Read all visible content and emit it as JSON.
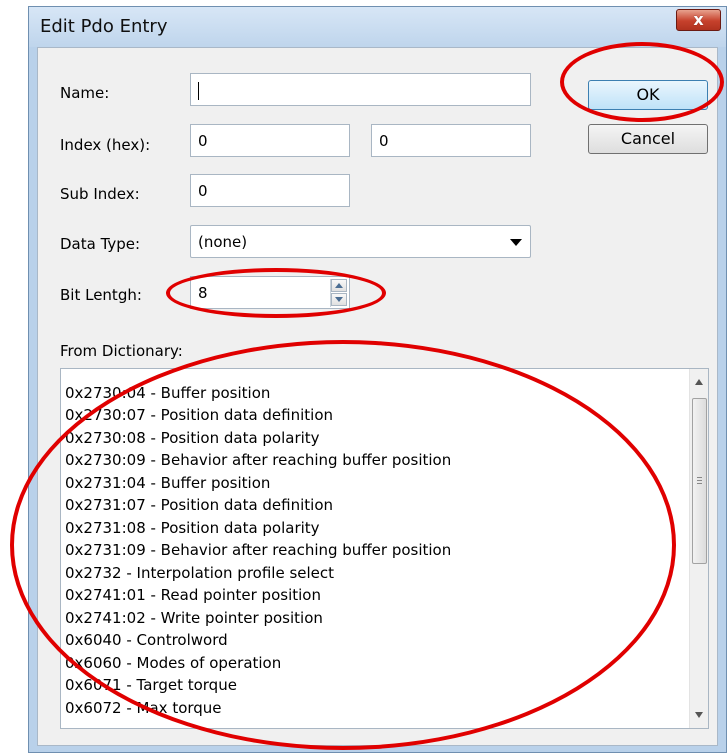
{
  "window": {
    "title": "Edit Pdo Entry",
    "close_glyph": "x",
    "close_icon": "close-icon"
  },
  "form": {
    "name_label": "Name:",
    "name_value": "",
    "index_label": "Index (hex):",
    "index_value_1": "0",
    "index_value_2": "0",
    "subindex_label": "Sub Index:",
    "subindex_value": "0",
    "datatype_label": "Data Type:",
    "datatype_value": "(none)",
    "bitlength_label": "Bit Lentgh:",
    "bitlength_value": "8"
  },
  "buttons": {
    "ok": "OK",
    "cancel": "Cancel"
  },
  "dictionary": {
    "label": "From Dictionary:",
    "items": [
      "0x2730:04 - Buffer position",
      "0x2730:07 - Position data definition",
      "0x2730:08 - Position data polarity",
      "0x2730:09 - Behavior after reaching buffer position",
      "0x2731:04 - Buffer position",
      "0x2731:07 - Position data definition",
      "0x2731:08 - Position data polarity",
      "0x2731:09 - Behavior after reaching buffer position",
      "0x2732 - Interpolation profile select",
      "0x2741:01 - Read pointer position",
      "0x2741:02 - Write pointer position",
      "0x6040 - Controlword",
      "0x6060 - Modes of operation",
      "0x6071 - Target torque",
      "0x6072 - Max torque"
    ]
  },
  "colors": {
    "annotation": "#e00000",
    "title_bar": "#bfd5ec",
    "close_button": "#c6412c"
  }
}
